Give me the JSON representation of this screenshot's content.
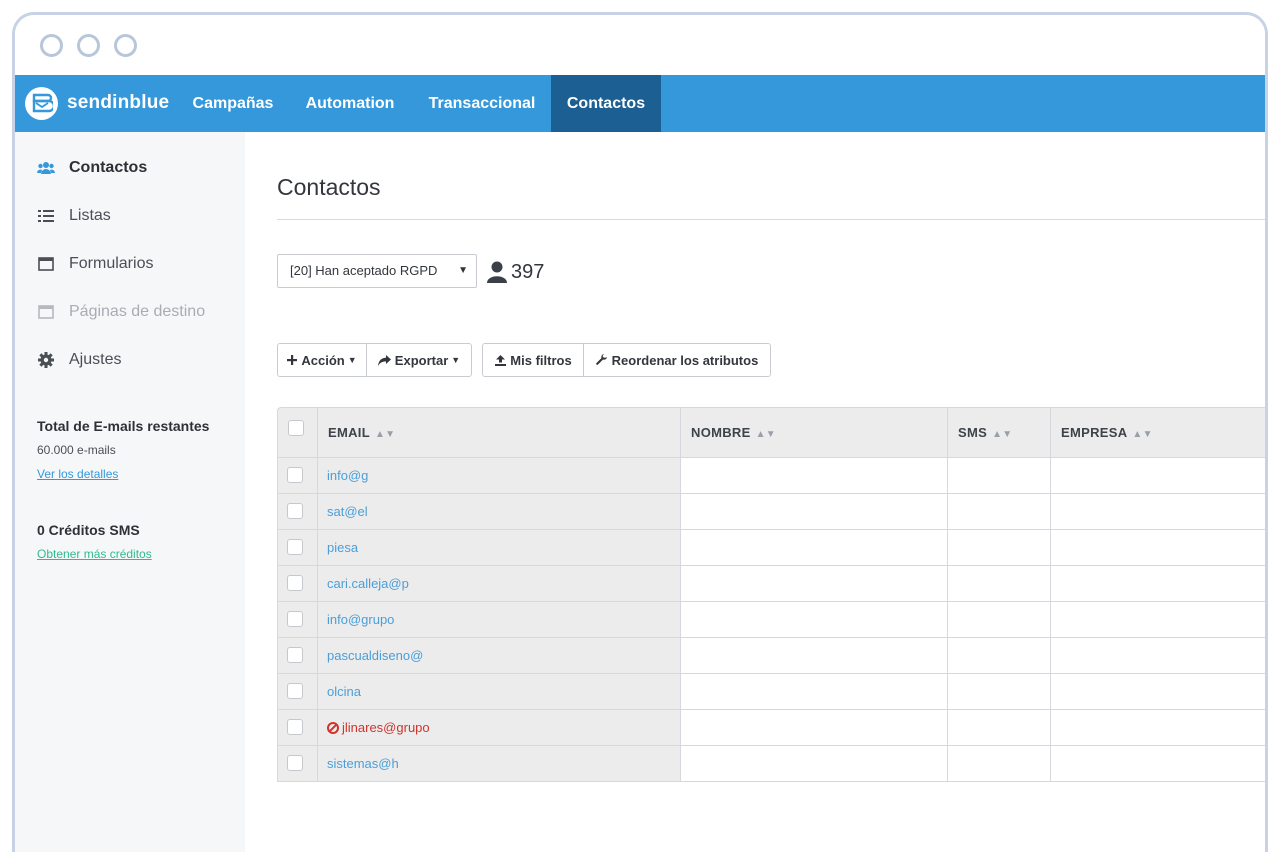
{
  "brand": {
    "name": "sendinblue"
  },
  "nav": {
    "items": [
      {
        "label": "Campañas"
      },
      {
        "label": "Automation"
      },
      {
        "label": "Transaccional"
      },
      {
        "label": "Contactos",
        "active": true
      }
    ]
  },
  "sidebar": {
    "items": [
      {
        "label": "Contactos",
        "icon": "users-icon",
        "active": true
      },
      {
        "label": "Listas",
        "icon": "list-icon"
      },
      {
        "label": "Formularios",
        "icon": "form-window-icon"
      },
      {
        "label": "Páginas de destino",
        "icon": "landing-page-icon",
        "disabled": true
      },
      {
        "label": "Ajustes",
        "icon": "gear-icon"
      }
    ],
    "emails_title": "Total de E-mails restantes",
    "emails_value": "60.000 e-mails",
    "emails_link": "Ver los detalles",
    "sms_title": "0 Créditos SMS",
    "sms_link": "Obtener más créditos"
  },
  "main": {
    "title": "Contactos",
    "list_select": "[20] Han aceptado RGPD",
    "contact_count": "397",
    "toolbar": {
      "accion": "Acción",
      "exportar": "Exportar",
      "mis_filtros": "Mis filtros",
      "reordenar": "Reordenar los atributos"
    },
    "table": {
      "columns": [
        "EMAIL",
        "NOMBRE",
        "SMS",
        "EMPRESA"
      ],
      "rows": [
        {
          "email": "info@g"
        },
        {
          "email": "sat@el"
        },
        {
          "email": "piesa"
        },
        {
          "email": "cari.calleja@p"
        },
        {
          "email": "info@grupo"
        },
        {
          "email": "pascualdiseno@"
        },
        {
          "email": "olcina"
        },
        {
          "email": "jlinares@grupo",
          "blocked": true
        },
        {
          "email": "sistemas@h"
        }
      ]
    }
  },
  "colors": {
    "nav": "#3498db",
    "nav_active": "#1c5f92",
    "link": "#4a9fd8",
    "blocked": "#d0342c",
    "green_link": "#2ebc8a"
  }
}
